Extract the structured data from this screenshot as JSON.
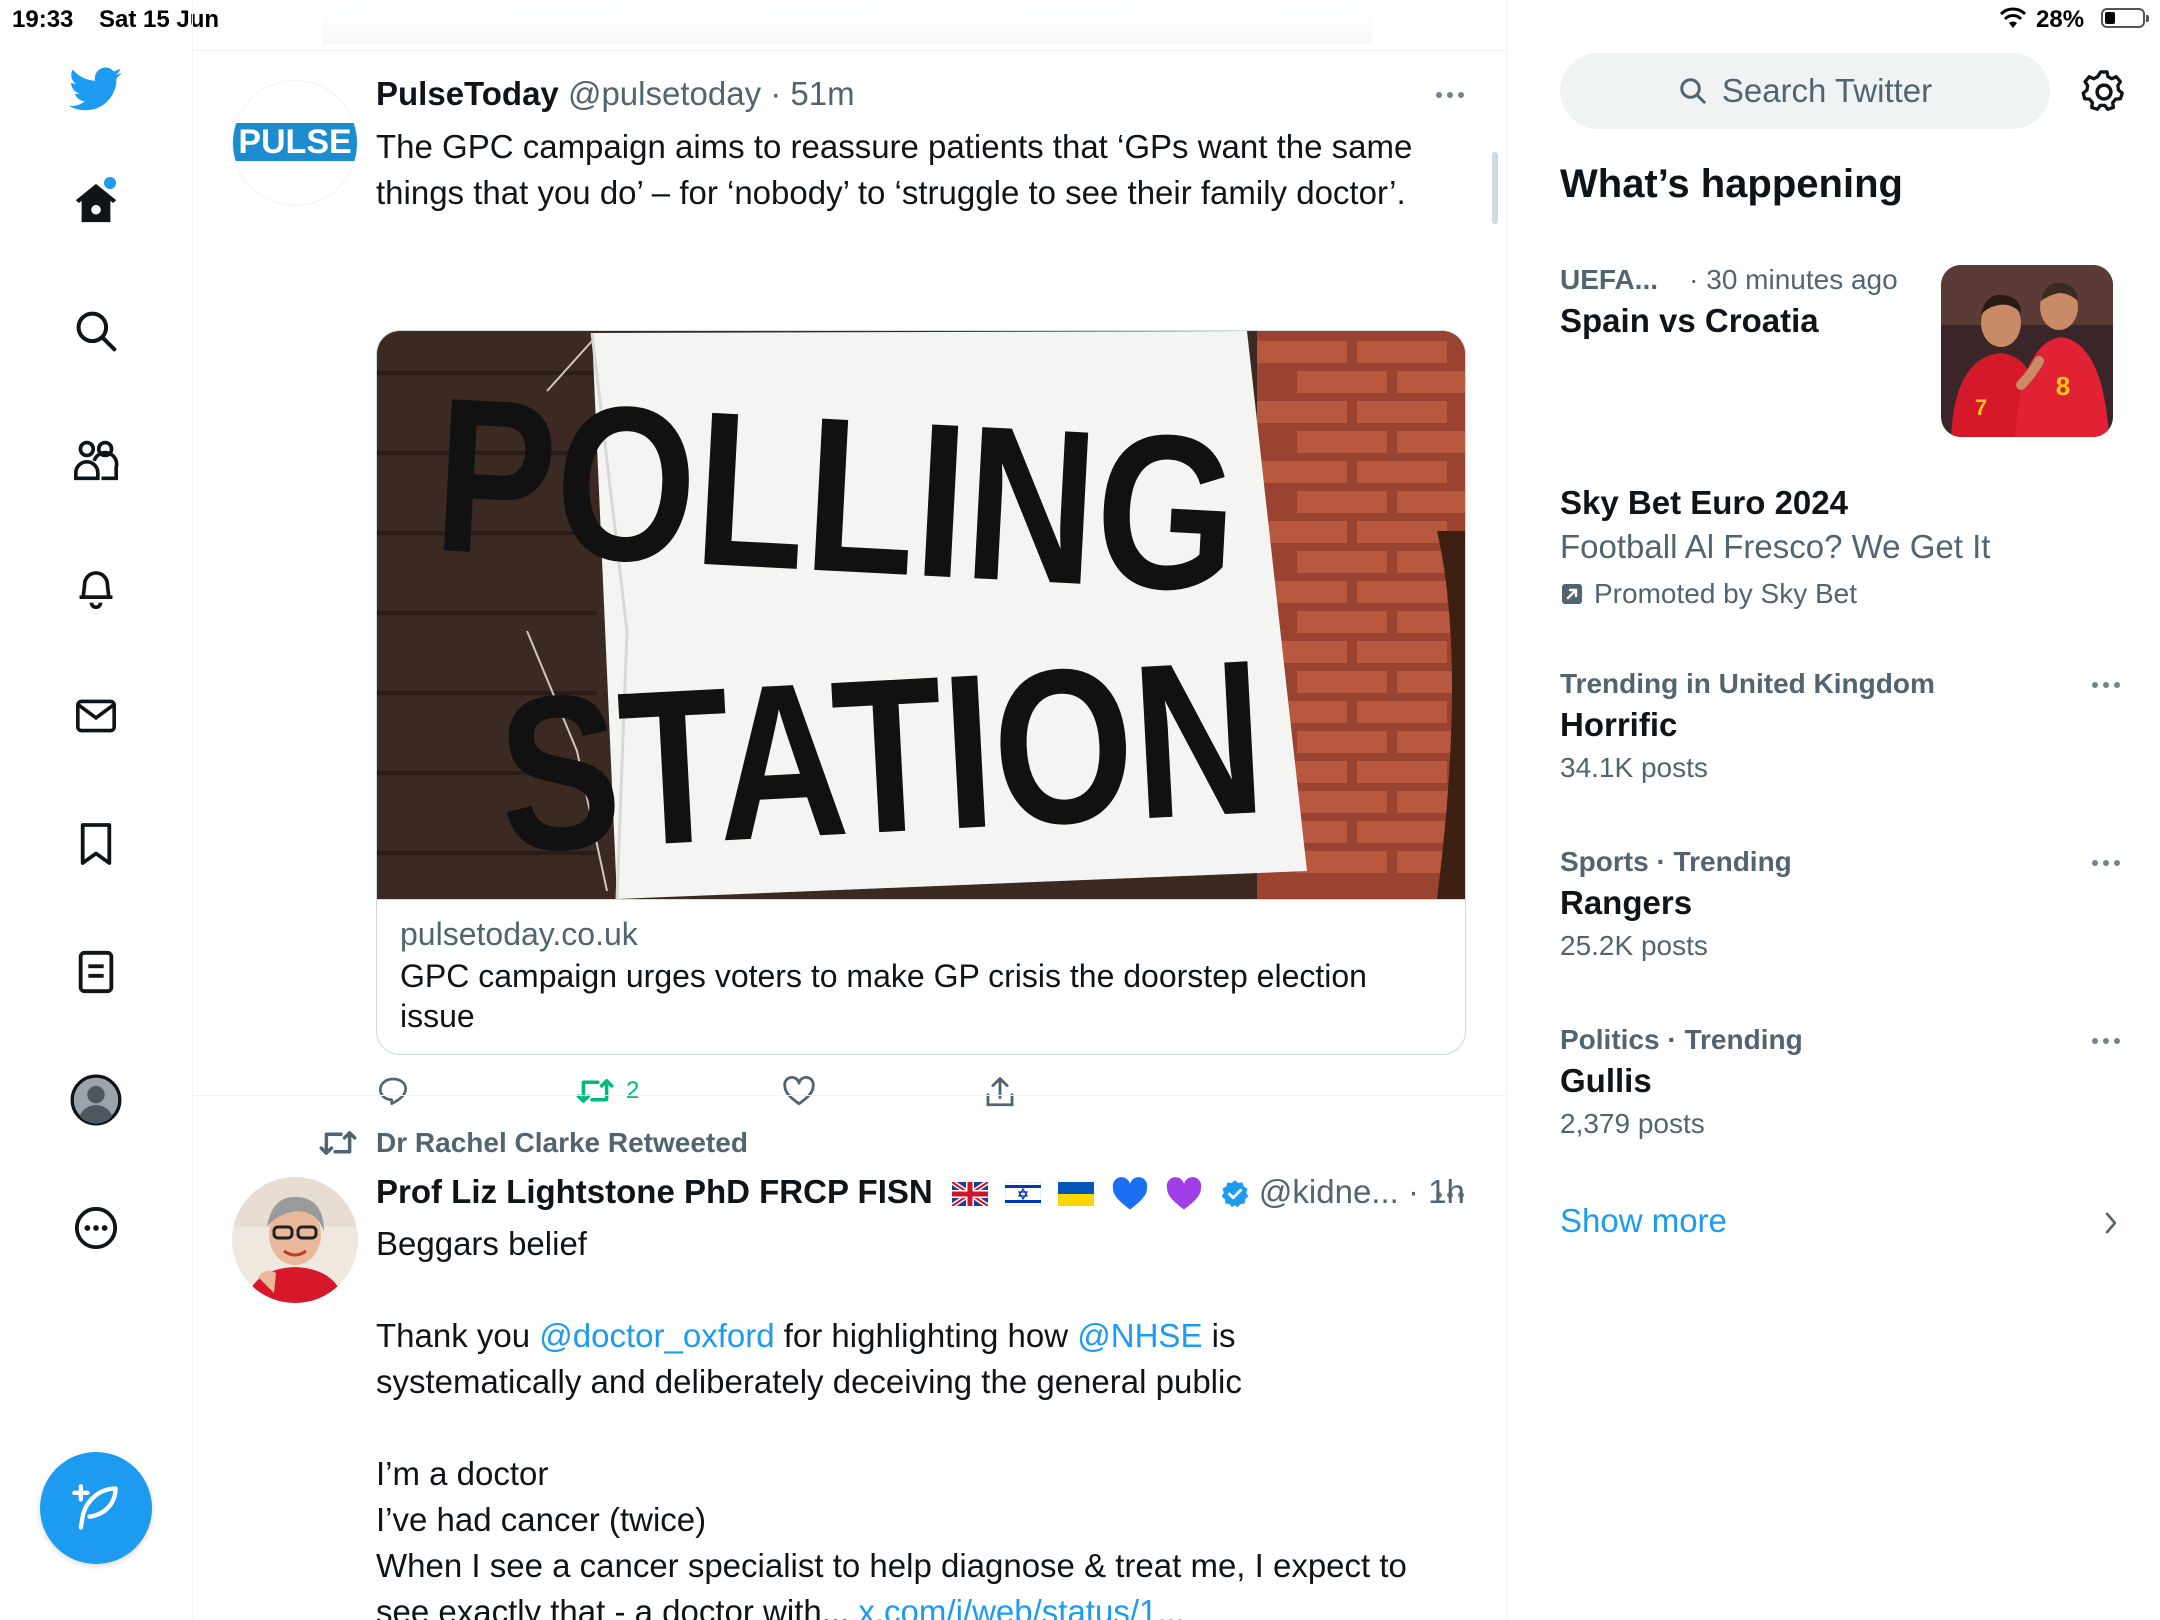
{
  "status_bar": {
    "time": "19:33",
    "date": "Sat 15 Jun",
    "battery": "28%",
    "battery_level": 0.28
  },
  "nav": {
    "items": [
      "twitter-logo",
      "home-icon",
      "search-icon",
      "communities-icon",
      "notifications-icon",
      "messages-icon",
      "bookmarks-icon",
      "lists-icon",
      "profile-icon",
      "more-icon"
    ],
    "compose": "compose-icon",
    "accent": "#1d9bf0"
  },
  "tweets": [
    {
      "name": "PulseToday",
      "handle": "@pulsetoday",
      "sep": "·",
      "time": "51m",
      "avatar_text": "PULSE",
      "text": "The GPC campaign aims to reassure patients that ‘GPs want the same things that you do’ – for ‘nobody’ to ‘struggle to see their family doctor’.",
      "card": {
        "image_text_top": "POLLING",
        "image_text_bottom": "STATION",
        "domain": "pulsetoday.co.uk",
        "title": "GPC campaign urges voters to make GP crisis the doorstep election issue"
      },
      "actions": {
        "retweets": "2",
        "retweet_color": "#00ba7c"
      }
    },
    {
      "retweeted_by": "Dr Rachel Clarke Retweeted",
      "name": "Prof Liz Lightstone PhD FRCP FISN",
      "handle": "@kidne...",
      "sep": "·",
      "time": "1h",
      "text_line1": "Beggars belief",
      "text_p2_a": "Thank you ",
      "mention1": "@doctor_oxford",
      "text_p2_b": " for highlighting how ",
      "mention2": "@NHSE",
      "text_p2_c": " is systematically and deliberately deceiving the general public",
      "text_line3": "I’m a doctor",
      "text_line4": "I’ve had cancer (twice)",
      "text_line5": "When I see a cancer specialist to help diagnose & treat me, I expect to see exactly that - a doctor with...",
      "link": "x.com/i/web/status/1..."
    }
  ],
  "sidebar": {
    "search_placeholder": "Search Twitter",
    "heading": "What’s happening",
    "trends": [
      {
        "context": "UEFA...",
        "context_light": "· 30 minutes ago",
        "title": "Spain vs Croatia"
      },
      {
        "context": "Trending in United Kingdom",
        "title": "Horrific",
        "count": "34.1K posts"
      },
      {
        "context": "Sports · Trending",
        "title": "Rangers",
        "count": "25.2K posts"
      },
      {
        "context": "Politics · Trending",
        "title": "Gullis",
        "count": "2,379 posts"
      }
    ],
    "promo": {
      "title": "Sky Bet Euro 2024",
      "subtitle": "Football Al Fresco? We Get It",
      "promoted_by": "Promoted by Sky Bet"
    },
    "show_more": "Show more"
  }
}
